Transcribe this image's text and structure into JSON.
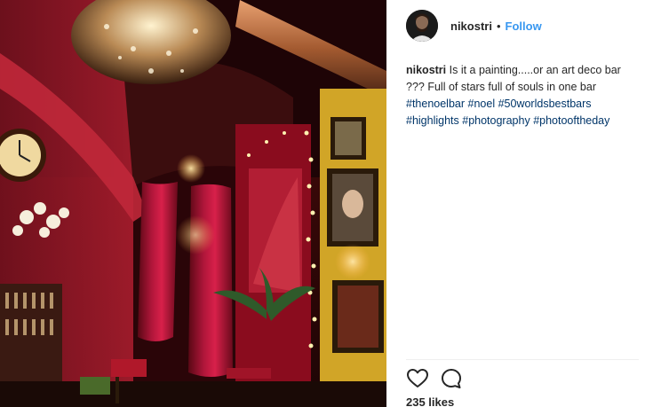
{
  "post": {
    "username": "nikostri",
    "separator": "•",
    "follow_label": "Follow",
    "caption": {
      "username": "nikostri",
      "text": "Is it a painting.....or an art deco bar ??? Full of stars full of souls in one bar",
      "hashtags": [
        "#thenoelbar",
        "#noel",
        "#50worldsbestbars",
        "#highlights",
        "#photography",
        "#photooftheday"
      ]
    },
    "likes_text": "235 likes"
  },
  "icons": {
    "like": "heart-icon",
    "comment": "comment-icon"
  },
  "colors": {
    "follow": "#3897f0",
    "hashtag": "#003569",
    "text": "#262626",
    "divider": "#efefef"
  }
}
